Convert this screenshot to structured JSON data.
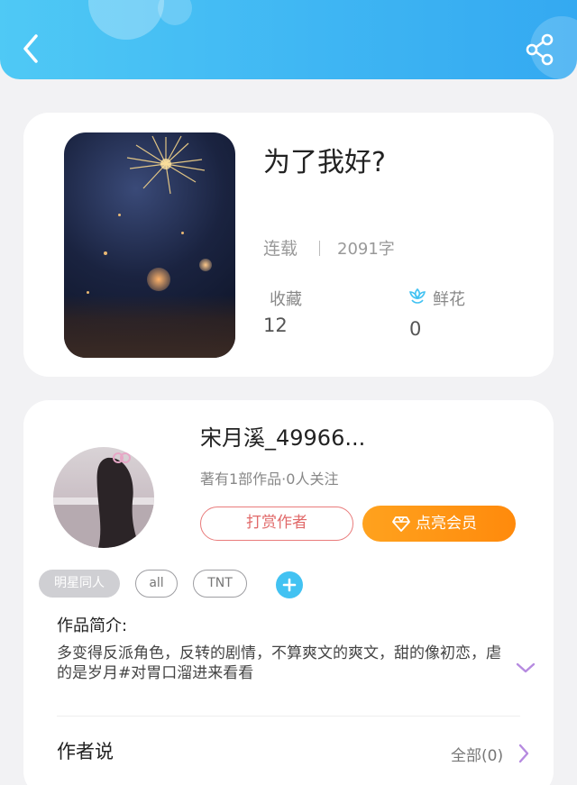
{
  "book": {
    "title": "为了我好?",
    "status": "连载",
    "word_count": "2091字",
    "favorites_label": "收藏",
    "favorites_count": "12",
    "flowers_label": "鲜花",
    "flowers_count": "0"
  },
  "author": {
    "name": "宋月溪_49966...",
    "meta": "著有1部作品·0人关注",
    "tip_button": "打赏作者",
    "vip_button": "点亮会员"
  },
  "tags": [
    "明星同人",
    "all",
    "TNT"
  ],
  "intro": {
    "heading": "作品简介:",
    "text": "多变得反派角色，反转的剧情，不算爽文的爽文，甜的像初恋，虐的是岁月#对胃口溜进来看看"
  },
  "author_says": {
    "heading": "作者说",
    "all_link": "全部(0)"
  },
  "colors": {
    "header_start": "#4fc9f5",
    "header_end": "#34a9f1",
    "vip_orange": "#ff8a0c",
    "tip_red": "#e16a6a",
    "accent_blue": "#42c2f2",
    "expand_purple": "#b68ae0"
  },
  "icons": {
    "back": "back-arrow-icon",
    "share": "share-icon",
    "flower": "flower-icon",
    "diamond": "diamond-icon",
    "add": "plus-icon",
    "expand": "chevron-down-icon",
    "more": "chevron-right-icon"
  }
}
